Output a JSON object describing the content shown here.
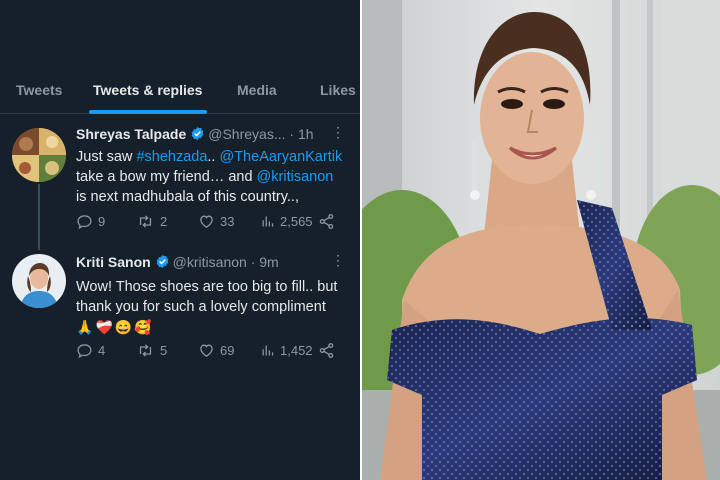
{
  "tabs": [
    {
      "label": "Tweets",
      "active": false
    },
    {
      "label": "Tweets & replies",
      "active": true
    },
    {
      "label": "Media",
      "active": false
    },
    {
      "label": "Likes",
      "active": false
    }
  ],
  "tweets": [
    {
      "name": "Shreyas Talpade",
      "handle": "@Shreyas...",
      "time": "1h",
      "verified": true,
      "text": {
        "l1_a": "Just saw ",
        "l1_hashtag": "#shehzada",
        "l1_b": ".. ",
        "l1_mention": "@TheAaryanKartik",
        "l2_a": "take a bow my friend… and ",
        "l2_mention": "@kritisanon",
        "l3": "is next madhubala of this country..,"
      },
      "stats": {
        "replies": "9",
        "retweets": "2",
        "likes": "33",
        "views": "2,565"
      }
    },
    {
      "name": "Kriti Sanon",
      "handle": "@kritisanon",
      "time": "9m",
      "verified": true,
      "text": {
        "l1": "Wow! Those shoes are too big to fill.. but",
        "l2": "thank you for such a lovely compliment",
        "emojis": [
          "🙏",
          "❤️‍🩹",
          "😄",
          "🥰"
        ]
      },
      "stats": {
        "replies": "4",
        "retweets": "5",
        "likes": "69",
        "views": "1,452"
      }
    }
  ],
  "colors": {
    "background": "#15202b",
    "accent": "#1d9bf0",
    "muted": "#8b98a5",
    "text": "#e7e9ea"
  },
  "icons": [
    "verified-badge-icon",
    "more-icon",
    "reply-icon",
    "retweet-icon",
    "like-icon",
    "views-icon",
    "share-icon"
  ],
  "photo": {
    "subject": "woman in dark blue sequined off-shoulder dress"
  }
}
